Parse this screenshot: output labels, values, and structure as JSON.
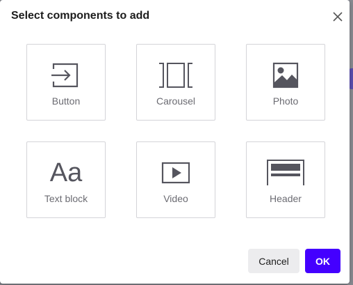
{
  "dialog": {
    "title": "Select components to add",
    "close_icon": "close-icon"
  },
  "components": [
    {
      "label": "Button",
      "icon": "button-icon"
    },
    {
      "label": "Carousel",
      "icon": "carousel-icon"
    },
    {
      "label": "Photo",
      "icon": "photo-icon"
    },
    {
      "label": "Text block",
      "icon": "text-block-icon",
      "glyph": "Aa"
    },
    {
      "label": "Video",
      "icon": "video-icon"
    },
    {
      "label": "Header",
      "icon": "header-icon"
    }
  ],
  "actions": {
    "cancel_label": "Cancel",
    "ok_label": "OK"
  },
  "colors": {
    "accent": "#4400ff",
    "icon": "#55555e",
    "label": "#6b6b72",
    "tile_border": "#d4d4d8"
  }
}
